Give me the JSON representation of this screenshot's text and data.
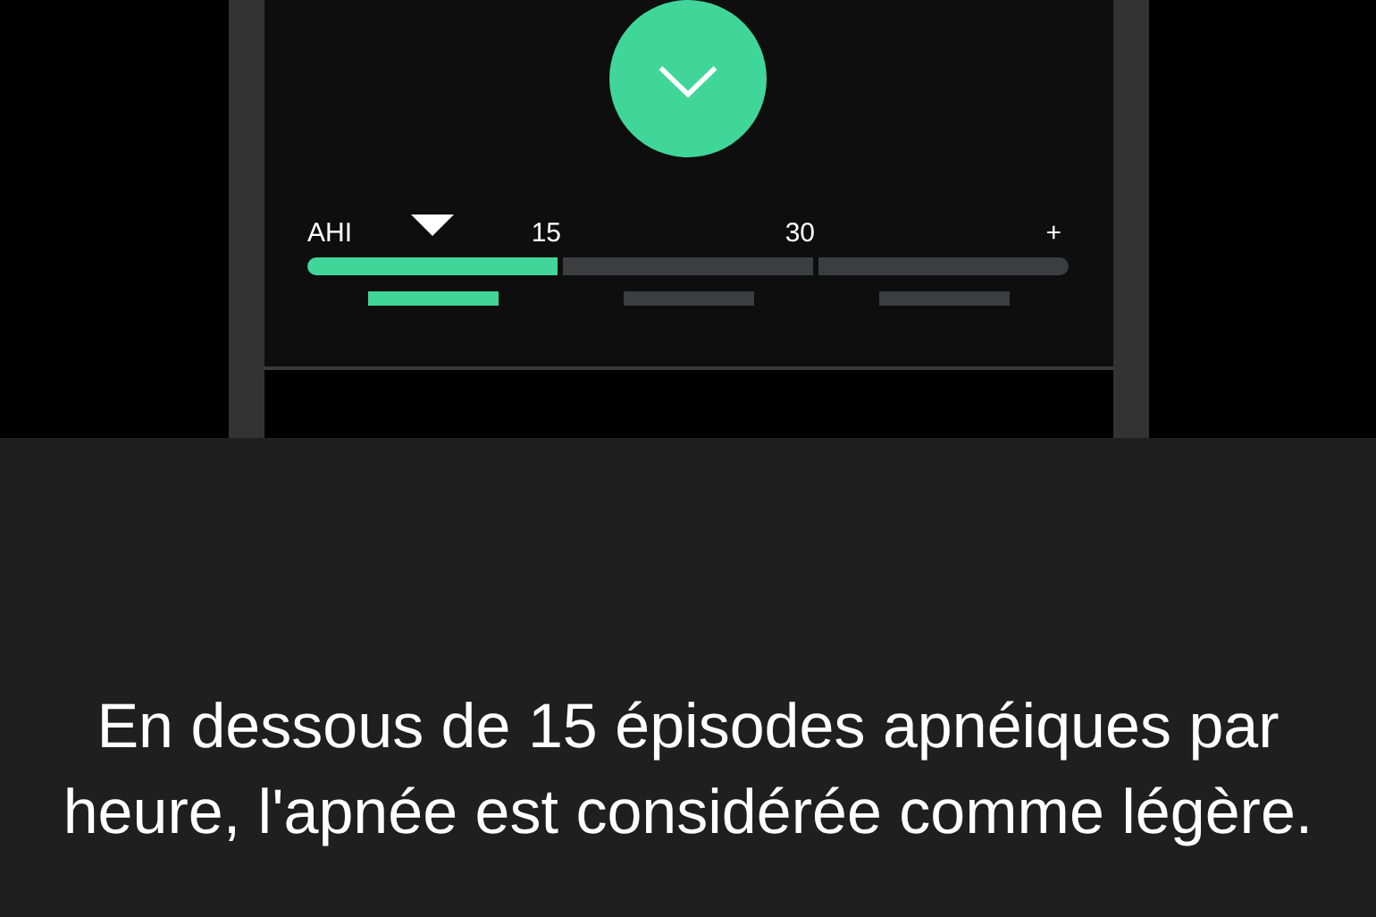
{
  "scale": {
    "label": "AHI",
    "ticks": [
      "15",
      "30",
      "+"
    ],
    "level": 0.165,
    "segments": [
      {
        "selected": true
      },
      {
        "selected": false
      },
      {
        "selected": false
      }
    ]
  },
  "message": "En dessous de 15 épisodes apnéiques par heure, l'apnée est considérée comme légère."
}
